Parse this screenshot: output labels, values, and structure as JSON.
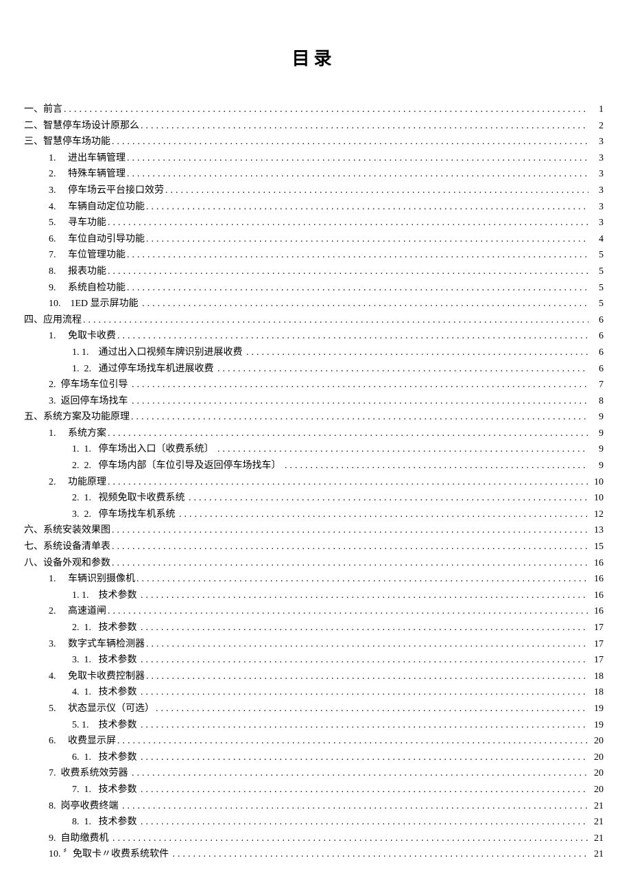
{
  "title": "目录",
  "toc": [
    {
      "indent": 0,
      "label": "一、前言",
      "page": "1"
    },
    {
      "indent": 0,
      "label": "二、智慧停车场设计原那么",
      "page": "2"
    },
    {
      "indent": 0,
      "label": "三、智慧停车场功能",
      "page": "3"
    },
    {
      "indent": 1,
      "label": "1.     进出车辆管理",
      "page": "3"
    },
    {
      "indent": 1,
      "label": "2.     特殊车辆管理",
      "page": "3"
    },
    {
      "indent": 1,
      "label": "3.     停车场云平台接口效劳",
      "page": "3"
    },
    {
      "indent": 1,
      "label": "4.     车辆自动定位功能",
      "page": "3"
    },
    {
      "indent": 1,
      "label": "5.     寻车功能",
      "page": "3"
    },
    {
      "indent": 1,
      "label": "6.     车位自动引导功能",
      "page": "4"
    },
    {
      "indent": 1,
      "label": "7.     车位管理功能",
      "page": "5"
    },
    {
      "indent": 1,
      "label": "8.     报表功能",
      "page": "5"
    },
    {
      "indent": 1,
      "label": "9.     系统自检功能",
      "page": "5"
    },
    {
      "indent": 1,
      "label": "10.    1ED 显示屏功能 ",
      "page": "5"
    },
    {
      "indent": 0,
      "label": "四、应用流程",
      "page": "6"
    },
    {
      "indent": 1,
      "label": "1.     免取卡收费",
      "page": "6"
    },
    {
      "indent": 2,
      "label": "1. 1.    通过出入口视频车牌识别进展收费 ",
      "page": "6"
    },
    {
      "indent": 2,
      "label": "1.  2.   通过停车场找车机进展收费 ",
      "page": "6"
    },
    {
      "indent": 1,
      "label": "2.  停车场车位引导 ",
      "page": "7"
    },
    {
      "indent": 1,
      "label": "3.  返回停车场找车 ",
      "page": "8"
    },
    {
      "indent": 0,
      "label": "五、系统方案及功能原理",
      "page": "9"
    },
    {
      "indent": 1,
      "label": "1.     系统方案",
      "page": "9"
    },
    {
      "indent": 2,
      "label": "1.  1.   停车场出入口〔收费系统〕 ",
      "page": "9"
    },
    {
      "indent": 2,
      "label": "2.  2.   停车场内部〔车位引导及返回停车场找车〕 ",
      "page": "9"
    },
    {
      "indent": 1,
      "label": "2.     功能原理",
      "page": "10"
    },
    {
      "indent": 2,
      "label": "2.  1.   视频免取卡收费系统 ",
      "page": "10"
    },
    {
      "indent": 2,
      "label": "3.  2.   停车场找车机系统 ",
      "page": "12"
    },
    {
      "indent": 0,
      "label": "六、系统安装效果图",
      "page": "13"
    },
    {
      "indent": 0,
      "label": "七、系统设备清单表",
      "page": "15"
    },
    {
      "indent": 0,
      "label": "八、设备外观和参数",
      "page": "16"
    },
    {
      "indent": 1,
      "label": "1.     车辆识别摄像机",
      "page": "16"
    },
    {
      "indent": 2,
      "label": "1. 1.    技术参数 ",
      "page": "16"
    },
    {
      "indent": 1,
      "label": "2.     高速道闸",
      "page": "16"
    },
    {
      "indent": 2,
      "label": "2.  1.   技术参数 ",
      "page": "17"
    },
    {
      "indent": 1,
      "label": "3.     数字式车辆检测器",
      "page": "17"
    },
    {
      "indent": 2,
      "label": "3.  1.   技术参数 ",
      "page": "17"
    },
    {
      "indent": 1,
      "label": "4.     免取卡收费控制器",
      "page": "18"
    },
    {
      "indent": 2,
      "label": "4.  1.   技术参数 ",
      "page": "18"
    },
    {
      "indent": 1,
      "label": "5.     状态显示仪（可选）",
      "page": "19"
    },
    {
      "indent": 2,
      "label": "5. 1.    技术参数 ",
      "page": "19"
    },
    {
      "indent": 1,
      "label": "6.     收费显示屏",
      "page": "20"
    },
    {
      "indent": 2,
      "label": "6.  1.   技术参数 ",
      "page": "20"
    },
    {
      "indent": 1,
      "label": "7.  收费系统效劳器 ",
      "page": "20"
    },
    {
      "indent": 2,
      "label": "7.  1.   技术参数 ",
      "page": "20"
    },
    {
      "indent": 1,
      "label": "8.  岗亭收费终端 ",
      "page": "21"
    },
    {
      "indent": 2,
      "label": "8.  1.   技术参数 ",
      "page": "21"
    },
    {
      "indent": 1,
      "label": "9.  自助缴费机 ",
      "page": "21"
    },
    {
      "indent": 1,
      "label": "10. 〞免取卡〃收费系统软件 ",
      "page": "21"
    }
  ]
}
